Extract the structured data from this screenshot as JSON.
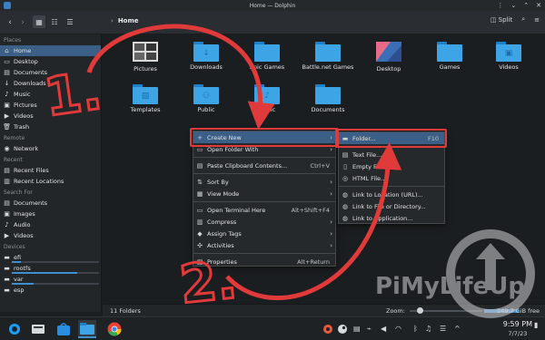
{
  "window": {
    "title": "Home — Dolphin"
  },
  "toolbar": {
    "breadcrumb_sep": "›",
    "breadcrumb": "Home",
    "split_label": "Split"
  },
  "sidebar": {
    "places_header": "Places",
    "places": [
      "Home",
      "Desktop",
      "Documents",
      "Downloads",
      "Music",
      "Pictures",
      "Videos",
      "Trash"
    ],
    "remote_header": "Remote",
    "remote": [
      "Network"
    ],
    "recent_header": "Recent",
    "recent": [
      "Recent Files",
      "Recent Locations"
    ],
    "search_header": "Search For",
    "search": [
      "Documents",
      "Images",
      "Audio",
      "Videos"
    ],
    "devices_header": "Devices",
    "devices": [
      {
        "label": "efi",
        "usage": 0.1
      },
      {
        "label": "rootfs",
        "usage": 0.75
      },
      {
        "label": "var",
        "usage": 0.25
      },
      {
        "label": "esp",
        "usage": 0.15
      }
    ]
  },
  "folders": [
    "Pictures",
    "Downloads",
    "Epic Games",
    "Battle.net Games",
    "Desktop",
    "Games",
    "Videos",
    "Templates",
    "Public",
    "Music",
    "Documents"
  ],
  "context_menu": {
    "items": [
      {
        "label": "Create New",
        "icon": "plus-icon",
        "submenu": true
      },
      {
        "label": "Open Folder With",
        "icon": "folder-open-icon",
        "submenu": true
      },
      {
        "label": "Paste Clipboard Contents...",
        "icon": "paste-icon",
        "shortcut": "Ctrl+V"
      },
      {
        "label": "Sort By",
        "icon": "sort-icon",
        "submenu": true
      },
      {
        "label": "View Mode",
        "icon": "view-icon",
        "submenu": true
      },
      {
        "label": "Open Terminal Here",
        "icon": "terminal-icon",
        "shortcut": "Alt+Shift+F4"
      },
      {
        "label": "Compress",
        "icon": "archive-icon",
        "submenu": true
      },
      {
        "label": "Assign Tags",
        "icon": "tag-icon",
        "submenu": true
      },
      {
        "label": "Activities",
        "icon": "activities-icon",
        "submenu": true
      },
      {
        "label": "Properties",
        "icon": "properties-icon",
        "shortcut": "Alt+Return"
      }
    ]
  },
  "submenu": {
    "items": [
      {
        "label": "Folder...",
        "shortcut": "F10",
        "icon": "folder-icon"
      },
      {
        "label": "Text File...",
        "icon": "text-file-icon"
      },
      {
        "label": "Empty File",
        "icon": "empty-file-icon"
      },
      {
        "label": "HTML File...",
        "icon": "html-file-icon"
      },
      {
        "label": "Link to Location (URL)...",
        "icon": "link-icon"
      },
      {
        "label": "Link to File or Directory...",
        "icon": "link-icon"
      },
      {
        "label": "Link to Application...",
        "icon": "link-icon"
      }
    ]
  },
  "statusbar": {
    "count": "11 Folders",
    "zoom_label": "Zoom:",
    "free": "249.7 GiB free",
    "free_fraction": 0.25
  },
  "taskbar": {
    "time": "9:59 PM",
    "date": "7/7/23"
  },
  "annotations": {
    "step1": "1.",
    "step2": "2.",
    "watermark": "PiMyLifeUp",
    "color": "#e03a3a"
  }
}
